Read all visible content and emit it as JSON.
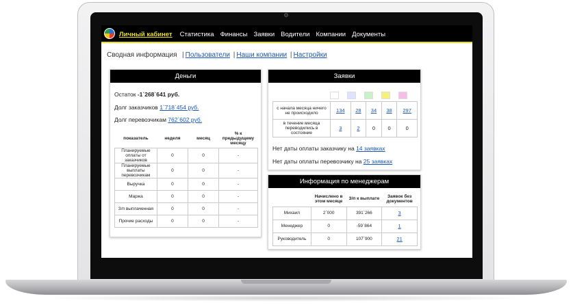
{
  "topbar": {
    "active": "Личный кабинет",
    "items": [
      "Статистика",
      "Финансы",
      "Заявки",
      "Водители",
      "Компании",
      "Документы"
    ]
  },
  "subnav": {
    "current": "Сводная информация",
    "links": [
      "Пользователи",
      "Наши компании",
      "Настройки"
    ]
  },
  "money": {
    "title": "Деньги",
    "balance_label": "Остаток",
    "balance_value": "-1`268`641 руб.",
    "customers_debt_label": "Долг заказчиков",
    "customers_debt_value": "1`718`454 руб.",
    "carriers_debt_label": "Долг перевозчикам",
    "carriers_debt_value": "762`602 руб.",
    "headers": [
      "показатель",
      "неделя",
      "месяц",
      "% к предыдущему месяцу"
    ],
    "rows": [
      [
        "Планируемые оплаты от заказчиков",
        "0",
        "0",
        "-"
      ],
      [
        "Планируемые выплаты перевозчикам",
        "0",
        "0",
        "-"
      ],
      [
        "Выручка",
        "0",
        "0",
        "-"
      ],
      [
        "Маржа",
        "0",
        "0",
        "-"
      ],
      [
        "З/п выплаченная",
        "0",
        "0",
        "-"
      ],
      [
        "Прочие расходы",
        "0",
        "0",
        "-"
      ]
    ]
  },
  "orders": {
    "title": "Заявки",
    "swatch_colors": [
      "#ffffff",
      "#dfe3fb",
      "#c9f2c9",
      "#f7f07a",
      "#f5bde8"
    ],
    "rows": [
      {
        "label": "с начала месяца ничего не происходило",
        "values": [
          "134",
          "28",
          "34",
          "38",
          "297"
        ]
      },
      {
        "label": "в течение месяца переводились в состояние",
        "values": [
          "3",
          "2",
          "0",
          "0",
          "0"
        ]
      }
    ],
    "note1_text": "Нет даты оплаты заказчику на",
    "note1_link": "14 заявках",
    "note2_text": "Нет даты оплаты перевозчику на",
    "note2_link": "25 заявках"
  },
  "managers": {
    "title": "Информация по менеджерам",
    "headers": [
      "",
      "Начислено в этом месяце",
      "З/п к выплате",
      "Заявок без документов"
    ],
    "rows": [
      [
        "Михаил",
        "2`000",
        "391`266",
        "3"
      ],
      [
        "Менеджер",
        "0",
        "-59`864",
        "1"
      ],
      [
        "Руководитель",
        "0",
        "107`900",
        "21"
      ]
    ]
  },
  "colors": {
    "accent_yellow": "#e7df1d",
    "link_blue": "#1a56b6",
    "header_black": "#000000"
  }
}
